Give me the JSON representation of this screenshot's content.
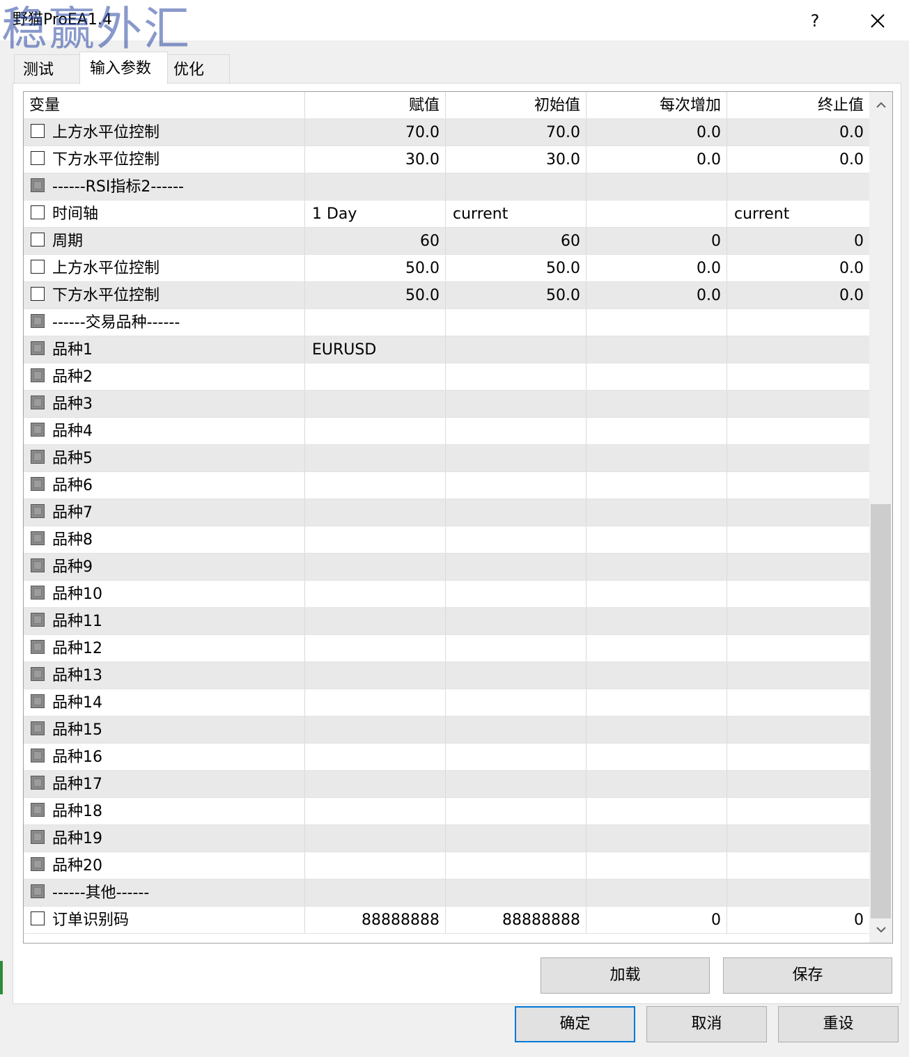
{
  "window": {
    "title": "野猫ProEA1.4",
    "watermark": "稳赢外汇",
    "help_label": "?"
  },
  "tabs": [
    {
      "label": "测试"
    },
    {
      "label": "输入参数"
    },
    {
      "label": "优化"
    }
  ],
  "table": {
    "headers": [
      "变量",
      "赋值",
      "初始值",
      "每次增加",
      "终止值"
    ],
    "rows": [
      {
        "name": "上方水平位控制",
        "value": "70.0",
        "start": "70.0",
        "step": "0.0",
        "stop": "0.0",
        "checkbox": "unchecked"
      },
      {
        "name": "下方水平位控制",
        "value": "30.0",
        "start": "30.0",
        "step": "0.0",
        "stop": "0.0",
        "checkbox": "unchecked"
      },
      {
        "name": "------RSI指标2------",
        "value": "",
        "start": "",
        "step": "",
        "stop": "",
        "checkbox": "disabled"
      },
      {
        "name": "时间轴",
        "value": "1 Day",
        "start": "current",
        "step": "",
        "stop": "current",
        "checkbox": "unchecked"
      },
      {
        "name": "周期",
        "value": "60",
        "start": "60",
        "step": "0",
        "stop": "0",
        "checkbox": "unchecked"
      },
      {
        "name": "上方水平位控制",
        "value": "50.0",
        "start": "50.0",
        "step": "0.0",
        "stop": "0.0",
        "checkbox": "unchecked"
      },
      {
        "name": "下方水平位控制",
        "value": "50.0",
        "start": "50.0",
        "step": "0.0",
        "stop": "0.0",
        "checkbox": "unchecked"
      },
      {
        "name": "------交易品种------",
        "value": "",
        "start": "",
        "step": "",
        "stop": "",
        "checkbox": "disabled"
      },
      {
        "name": "品种1",
        "value": "EURUSD",
        "start": "",
        "step": "",
        "stop": "",
        "checkbox": "disabled"
      },
      {
        "name": "品种2",
        "value": "",
        "start": "",
        "step": "",
        "stop": "",
        "checkbox": "disabled"
      },
      {
        "name": "品种3",
        "value": "",
        "start": "",
        "step": "",
        "stop": "",
        "checkbox": "disabled"
      },
      {
        "name": "品种4",
        "value": "",
        "start": "",
        "step": "",
        "stop": "",
        "checkbox": "disabled"
      },
      {
        "name": "品种5",
        "value": "",
        "start": "",
        "step": "",
        "stop": "",
        "checkbox": "disabled"
      },
      {
        "name": "品种6",
        "value": "",
        "start": "",
        "step": "",
        "stop": "",
        "checkbox": "disabled"
      },
      {
        "name": "品种7",
        "value": "",
        "start": "",
        "step": "",
        "stop": "",
        "checkbox": "disabled"
      },
      {
        "name": "品种8",
        "value": "",
        "start": "",
        "step": "",
        "stop": "",
        "checkbox": "disabled"
      },
      {
        "name": "品种9",
        "value": "",
        "start": "",
        "step": "",
        "stop": "",
        "checkbox": "disabled"
      },
      {
        "name": "品种10",
        "value": "",
        "start": "",
        "step": "",
        "stop": "",
        "checkbox": "disabled"
      },
      {
        "name": "品种11",
        "value": "",
        "start": "",
        "step": "",
        "stop": "",
        "checkbox": "disabled"
      },
      {
        "name": "品种12",
        "value": "",
        "start": "",
        "step": "",
        "stop": "",
        "checkbox": "disabled"
      },
      {
        "name": "品种13",
        "value": "",
        "start": "",
        "step": "",
        "stop": "",
        "checkbox": "disabled"
      },
      {
        "name": "品种14",
        "value": "",
        "start": "",
        "step": "",
        "stop": "",
        "checkbox": "disabled"
      },
      {
        "name": "品种15",
        "value": "",
        "start": "",
        "step": "",
        "stop": "",
        "checkbox": "disabled"
      },
      {
        "name": "品种16",
        "value": "",
        "start": "",
        "step": "",
        "stop": "",
        "checkbox": "disabled"
      },
      {
        "name": "品种17",
        "value": "",
        "start": "",
        "step": "",
        "stop": "",
        "checkbox": "disabled"
      },
      {
        "name": "品种18",
        "value": "",
        "start": "",
        "step": "",
        "stop": "",
        "checkbox": "disabled"
      },
      {
        "name": "品种19",
        "value": "",
        "start": "",
        "step": "",
        "stop": "",
        "checkbox": "disabled"
      },
      {
        "name": "品种20",
        "value": "",
        "start": "",
        "step": "",
        "stop": "",
        "checkbox": "disabled"
      },
      {
        "name": "------其他------",
        "value": "",
        "start": "",
        "step": "",
        "stop": "",
        "checkbox": "disabled"
      },
      {
        "name": "订单识别码",
        "value": "88888888",
        "start": "88888888",
        "step": "0",
        "stop": "0",
        "checkbox": "unchecked"
      }
    ]
  },
  "buttons": {
    "load": "加载",
    "save": "保存",
    "ok": "确定",
    "cancel": "取消",
    "reset": "重设"
  },
  "colors": {
    "default_button_border": "#0078d7",
    "alt_row": "#e9e9e9",
    "watermark": "#2846a0"
  }
}
